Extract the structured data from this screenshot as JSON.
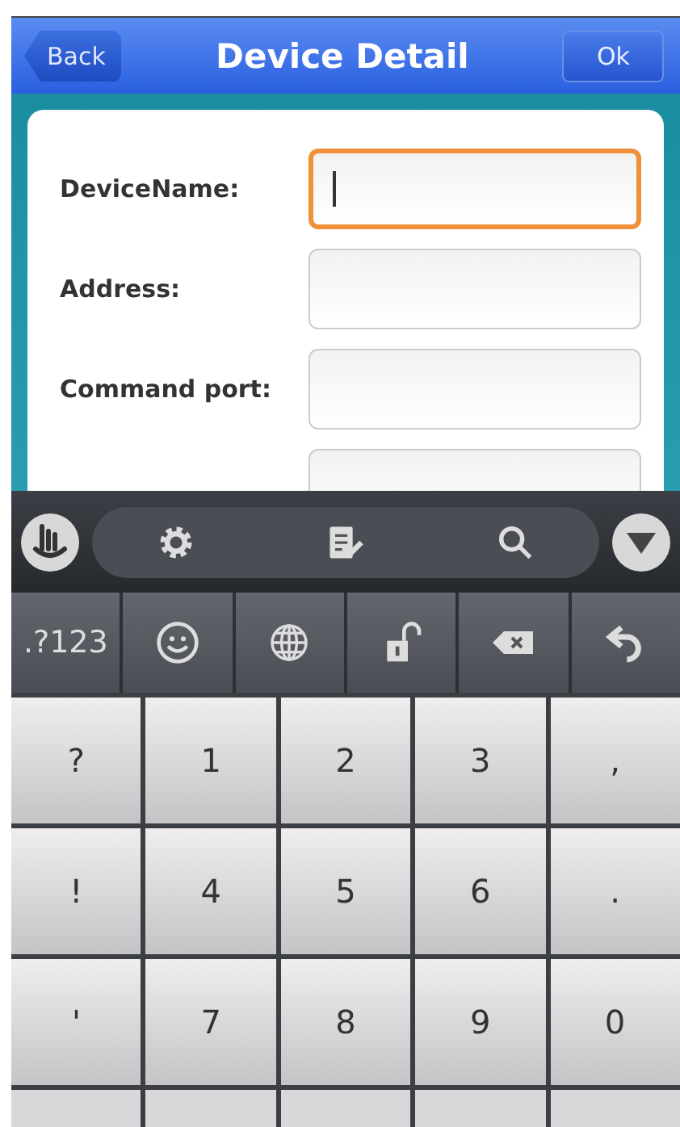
{
  "header": {
    "back": "Back",
    "title": "Device Detail",
    "ok": "Ok"
  },
  "fields": [
    {
      "label": "DeviceName:",
      "focused": true
    },
    {
      "label": "Address:",
      "focused": false
    },
    {
      "label": "Command port:",
      "focused": false
    }
  ],
  "function_keys": [
    {
      "kind": "symbols",
      "label": ".?123"
    },
    {
      "kind": "emoji"
    },
    {
      "kind": "globe"
    },
    {
      "kind": "lock"
    },
    {
      "kind": "backspace"
    },
    {
      "kind": "enter"
    }
  ],
  "keys": [
    [
      "?",
      "1",
      "2",
      "3",
      ","
    ],
    [
      "!",
      "4",
      "5",
      "6",
      "."
    ],
    [
      "'",
      "7",
      "8",
      "9",
      "0"
    ]
  ]
}
